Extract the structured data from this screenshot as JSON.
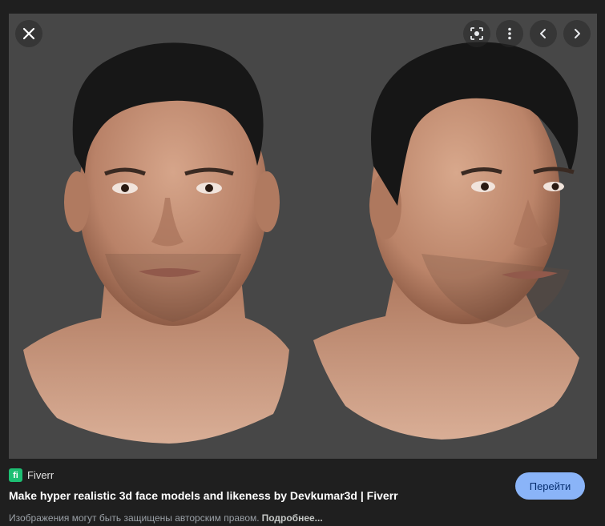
{
  "viewer": {
    "close_icon": "close-icon",
    "lens_icon": "lens-icon",
    "more_icon": "more-vert-icon",
    "prev_icon": "chevron-left-icon",
    "next_icon": "chevron-right-icon",
    "image_description_visible": false
  },
  "source": {
    "logo_text": "fi",
    "name": "Fiverr"
  },
  "title": "Make hyper realistic 3d face models and likeness by Devkumar3d | Fiverr",
  "copyright": {
    "text": "Изображения могут быть защищены авторским правом.",
    "link": "Подробнее..."
  },
  "visit_button": "Перейти",
  "colors": {
    "background": "#1f1f1f",
    "viewer": "#474747",
    "button": "#8ab4f8",
    "fiverr": "#1dbf73"
  }
}
